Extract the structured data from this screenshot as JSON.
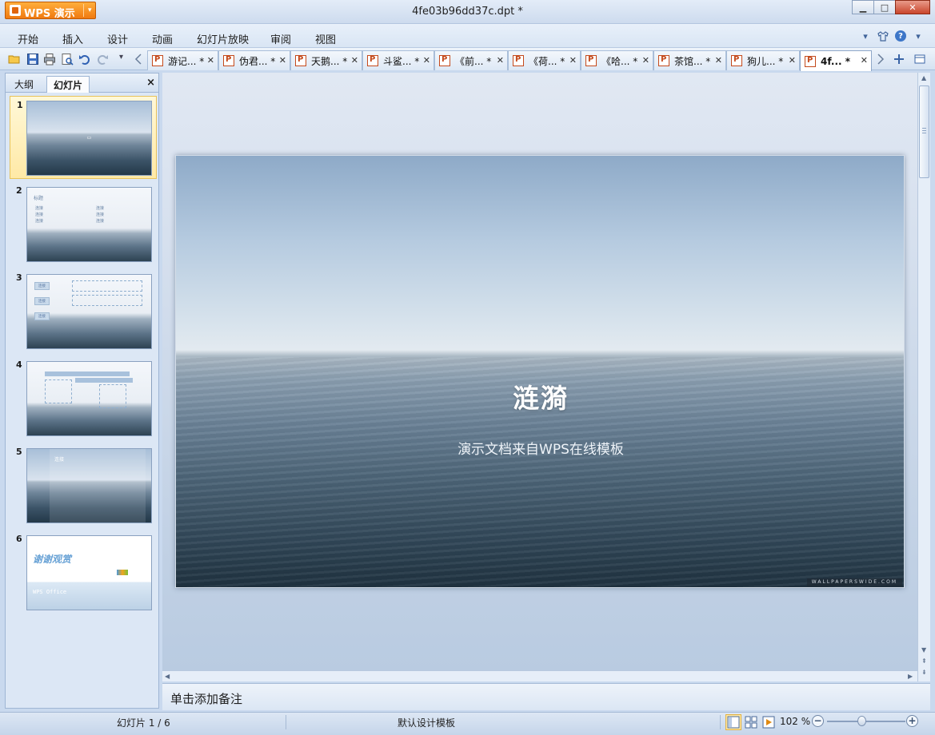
{
  "window": {
    "app_label": "WPS 演示",
    "doc_title": "4fe03b96dd37c.dpt *",
    "min_icon": "minimize-icon",
    "max_icon": "maximize-icon",
    "close_icon": "close-icon"
  },
  "menu": {
    "items": [
      "开始",
      "插入",
      "设计",
      "动画",
      "幻灯片放映",
      "审阅",
      "视图"
    ]
  },
  "doc_tabs": [
    {
      "name": "游记... *"
    },
    {
      "name": "伪君... *"
    },
    {
      "name": "天鹅... *"
    },
    {
      "name": "斗鲨... *"
    },
    {
      "name": "《前... *"
    },
    {
      "name": "《荷... *"
    },
    {
      "name": "《哈... *"
    },
    {
      "name": "茶馆... *"
    },
    {
      "name": "狗儿... *"
    },
    {
      "name": "4f... *"
    }
  ],
  "left_pane": {
    "tab_outline": "大纲",
    "tab_slides": "幻灯片",
    "close": "×",
    "slides": [
      {
        "num": "1"
      },
      {
        "num": "2",
        "title": "标题",
        "items": [
          "连接",
          "连接",
          "连接"
        ]
      },
      {
        "num": "3",
        "labels": [
          "连接",
          "连接",
          "连接"
        ]
      },
      {
        "num": "4"
      },
      {
        "num": "5",
        "title": "连接"
      },
      {
        "num": "6",
        "title": "谢谢观赏",
        "footer": "WPS Office"
      }
    ]
  },
  "slide": {
    "title": "涟漪",
    "subtitle": "演示文档来自WPS在线模板",
    "watermark": "WALLPAPERSWIDE.COM"
  },
  "notes": {
    "placeholder": "单击添加备注"
  },
  "status": {
    "slide_pos": "幻灯片 1 / 6",
    "template": "默认设计模板",
    "zoom": "102 %",
    "zoom_fraction": 0.44
  },
  "colors": {
    "accent_orange": "#f07a10",
    "chrome_blue": "#d5e2f2"
  }
}
